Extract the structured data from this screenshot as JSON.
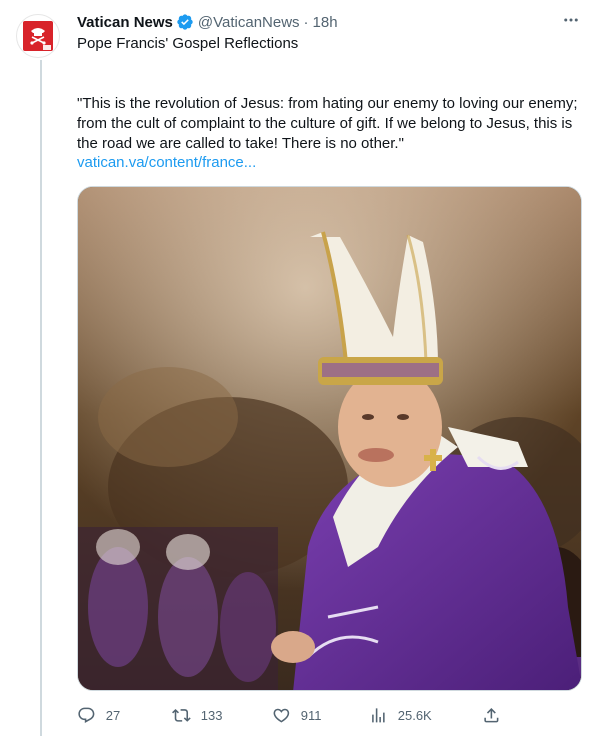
{
  "tweet": {
    "author_name": "Vatican News",
    "handle": "@VaticanNews",
    "separator": "·",
    "time": "18h",
    "avatar_text": "VATICAN NEWS",
    "subtitle": "Pope Francis' Gospel Reflections",
    "quote": "\"This is the revolution of Jesus: from hating our enemy to loving our enemy; from the cult of complaint to the culture of gift. If we belong to Jesus, this is the road we are called to take! There is no other.\"",
    "link": "vatican.va/content/france..."
  },
  "actions": {
    "replies": "27",
    "retweets": "133",
    "likes": "911",
    "views": "25.6K"
  },
  "colors": {
    "accent": "#1d9bf0",
    "secondary_text": "#536471",
    "brand_red": "#d8232a",
    "vestment_purple": "#5b2a8c"
  },
  "icons": {
    "verified": "verified-badge-icon",
    "more": "more-horizontal-icon",
    "reply": "reply-icon",
    "retweet": "retweet-icon",
    "like": "heart-icon",
    "views": "views-chart-icon",
    "share": "share-icon"
  }
}
